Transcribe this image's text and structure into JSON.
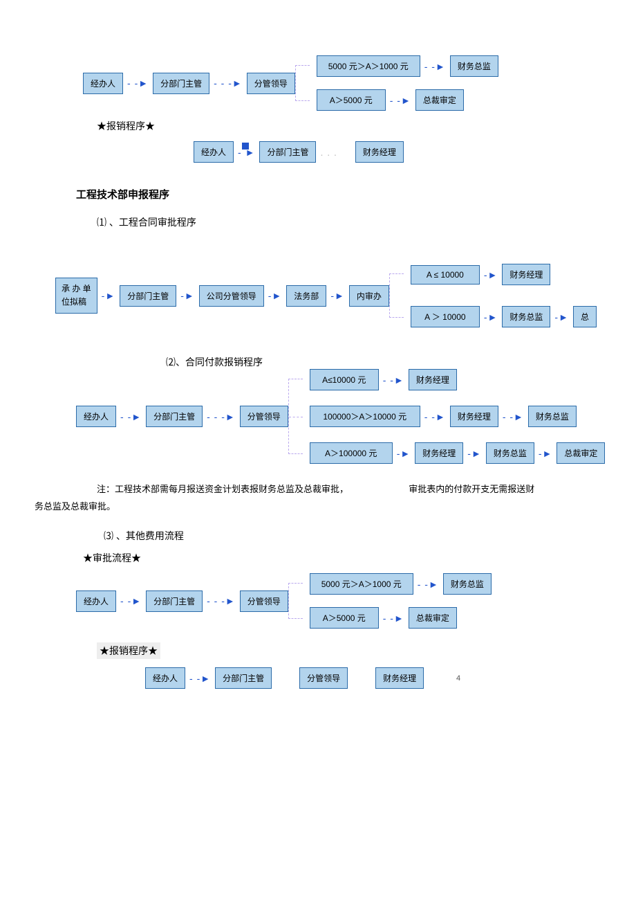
{
  "flow1": {
    "start": "经办人",
    "n2": "分部门主管",
    "n3": "分管领导",
    "branch1": {
      "cond": "5000 元＞A＞1000 元",
      "out": "财务总监"
    },
    "branch2": {
      "cond": "A＞5000 元",
      "out": "总裁审定"
    }
  },
  "label_reimburse": "★报销程序★",
  "flow1b": {
    "n1": "经办人",
    "n2": "分部门主管",
    "n3": "财务经理"
  },
  "heading_eng": "工程技术部申报程序",
  "sub1": "⑴ 、工程合同审批程序",
  "flow2": {
    "start1": "承 办 单",
    "start2": "位拟稿",
    "n2": "分部门主管",
    "n3": "公司分管领导",
    "n4": "法务部",
    "n5": "内审办",
    "branch1": {
      "cond": "A ≤ 10000",
      "out": "财务经理"
    },
    "branch2": {
      "cond": "A ＞ 10000",
      "out": "财务总监",
      "out2": "总"
    }
  },
  "sub2": "⑵、合同付款报销程序",
  "flow3": {
    "n1": "经办人",
    "n2": "分部门主管",
    "n3": "分管领导",
    "b1": {
      "cond": "A≤10000 元",
      "o1": "财务经理"
    },
    "b2": {
      "cond": "100000＞A＞10000 元",
      "o1": "财务经理",
      "o2": "财务总监"
    },
    "b3": {
      "cond": "A＞100000 元",
      "o1": "财务经理",
      "o2": "财务总监",
      "o3": "总裁审定"
    }
  },
  "note_a": "注：工程技术部需每月报送资金计划表报财务总监及总裁审批，",
  "note_b": "审批表内的付款开支无需报送财",
  "note_c": "务总监及总裁审批。",
  "sub3": "⑶  、其他费用流程",
  "label_approve": "★审批流程★",
  "flow4": {
    "n1": "经办人",
    "n2": "分部门主管",
    "n3": "分管领导",
    "branch1": {
      "cond": "5000 元＞A＞1000 元",
      "out": "财务总监"
    },
    "branch2": {
      "cond": "A＞5000 元",
      "out": "总裁审定"
    }
  },
  "label_reimburse2": "★报销程序★",
  "flow5": {
    "n1": "经办人",
    "n2": "分部门主管",
    "n3": "分管领导",
    "n4": "财务经理"
  },
  "page": "4"
}
